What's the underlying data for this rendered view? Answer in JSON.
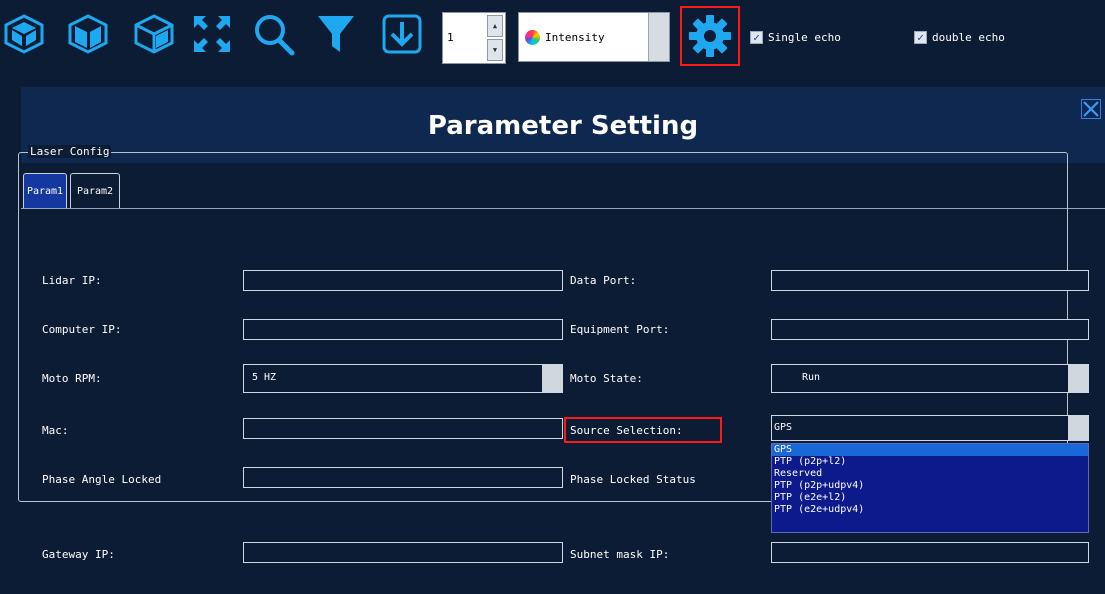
{
  "toolbar": {
    "icons": [
      "view-front-icon",
      "view-side-icon",
      "view-top-icon",
      "fit-view-icon",
      "zoom-icon",
      "filter-icon",
      "download-icon"
    ],
    "frame_spinner_value": "1",
    "color_mode": {
      "icon": "color-wheel-icon",
      "label": "Intensity"
    },
    "settings_icon": "gear-icon",
    "single_echo": {
      "label": "Single echo",
      "checked": true
    },
    "double_echo": {
      "label": "double echo",
      "checked": true
    },
    "accent_color": "#1ea8f0",
    "highlight_color": "#ff1a1a"
  },
  "dialog": {
    "title": "Parameter Setting",
    "close_icon": "close-icon",
    "tabs": [
      {
        "label": "Param1",
        "active": true
      },
      {
        "label": "Param2",
        "active": false
      }
    ],
    "group_title": "Laser Config",
    "fields": {
      "lidar_ip": {
        "label": "Lidar IP:",
        "value": ""
      },
      "data_port": {
        "label": "Data Port:",
        "value": ""
      },
      "computer_ip": {
        "label": "Computer IP:",
        "value": ""
      },
      "equipment_port": {
        "label": "Equipment Port:",
        "value": ""
      },
      "moto_rpm": {
        "label": "Moto RPM:",
        "value": "5 HZ"
      },
      "moto_state": {
        "label": "Moto State:",
        "value": "Run"
      },
      "mac": {
        "label": "Mac:",
        "value": ""
      },
      "source_selection": {
        "label": "Source Selection:",
        "value": "GPS"
      },
      "phase_angle_locked": {
        "label": "Phase Angle Locked",
        "value": ""
      },
      "phase_locked_status": {
        "label": "Phase Locked Status",
        "value": ""
      },
      "gateway_ip": {
        "label": "Gateway IP:",
        "value": ""
      },
      "subnet_mask_ip": {
        "label": "Subnet mask IP:",
        "value": ""
      }
    },
    "source_options": [
      "GPS",
      "PTP (p2p+l2)",
      "Reserved",
      "PTP (p2p+udpv4)",
      "PTP (e2e+l2)",
      "PTP (e2e+udpv4)"
    ],
    "source_selected_index": 0
  }
}
